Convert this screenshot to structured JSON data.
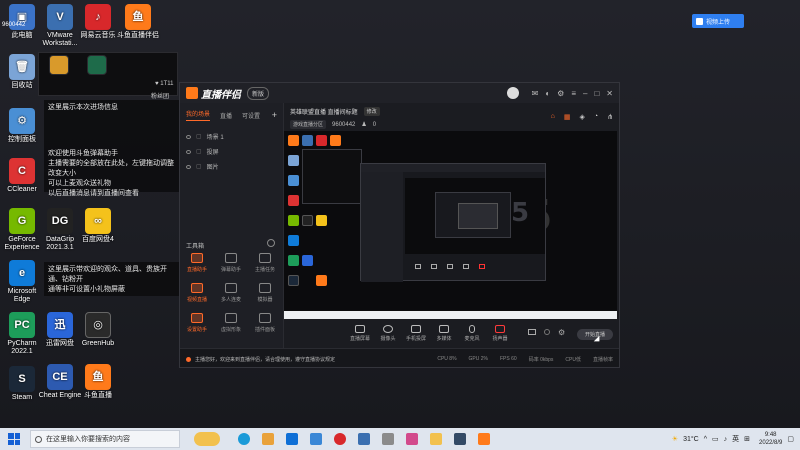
{
  "desktop": {
    "icons": [
      {
        "label": "此电脑",
        "color": "#3b73c8",
        "glyph": "▣"
      },
      {
        "label": "VMware Workstati...",
        "color": "#3b6fb0",
        "glyph": "V"
      },
      {
        "label": "网易云音乐",
        "color": "#d8282b",
        "glyph": "♪"
      },
      {
        "label": "斗鱼直播伴侣",
        "color": "#ff7a1a",
        "glyph": "鱼"
      },
      {
        "label": "回收站",
        "color": "#7ba4d6",
        "glyph": "🗑"
      },
      {
        "label": "控制面板",
        "color": "#4a8fd4",
        "glyph": "⚙"
      },
      {
        "label": "CCleaner",
        "color": "#d33",
        "glyph": "C"
      },
      {
        "label": "GeForce Experience",
        "color": "#76b900",
        "glyph": "G"
      },
      {
        "label": "DataGrip 2021.3.1",
        "color": "#222",
        "glyph": "DG"
      },
      {
        "label": "百度网盘4",
        "color": "#f4c21b",
        "glyph": "∞"
      },
      {
        "label": "Microsoft Edge",
        "color": "#0f7bd8",
        "glyph": "e"
      },
      {
        "label": "PyCharm 2022.1",
        "color": "#1d9d5a",
        "glyph": "PC"
      },
      {
        "label": "迅雷网盘",
        "color": "#2a66d9",
        "glyph": "迅"
      },
      {
        "label": "GreenHub",
        "color": "#2a2a2a",
        "glyph": "◎"
      },
      {
        "label": "Steam",
        "color": "#1b2838",
        "glyph": "S"
      },
      {
        "label": "Cheat Engine",
        "color": "#2d5ab0",
        "glyph": "CE"
      },
      {
        "label": "斗鱼直播",
        "color": "#ff7a1a",
        "glyph": "鱼"
      }
    ],
    "top_left_text": "9600442",
    "panel_stats": [
      "♥ 1T11",
      "粉丝团"
    ],
    "tip_lines": [
      "这里展示本次进场信息",
      "欢迎使用斗鱼弹幕助手",
      "主播需要的全部放在此处，左键拖动调整改变大小",
      "可以上麦观众送礼物",
      "以后直播消息请到直播间查看"
    ],
    "tip_lines2": [
      "这里展示带欢迎的观众、道具、贵族开通、钻粉开",
      "通等非可设置小礼物屏蔽"
    ]
  },
  "sys_button": "视频上传",
  "app": {
    "name": "直播伴侣",
    "badge": "新版",
    "tabs": [
      "我的场景",
      "直播",
      "可设置"
    ],
    "scenes": [
      "场景 1",
      "投屏",
      "图片"
    ],
    "tools_title": "工具箱",
    "tools": [
      {
        "label": "直播助手",
        "orange": true
      },
      {
        "label": "弹幕助手",
        "orange": false
      },
      {
        "label": "主播任务",
        "orange": false
      },
      {
        "label": "视频直播",
        "orange": true
      },
      {
        "label": "多人连麦",
        "orange": false
      },
      {
        "label": "模拟器",
        "orange": false
      },
      {
        "label": "设置助手",
        "orange": true
      },
      {
        "label": "虚拟形象",
        "orange": false
      },
      {
        "label": "插件面板",
        "orange": false
      }
    ],
    "preview_title": "英雄联盟直播 直播间标题",
    "preview_tag": "修改",
    "room_category": "游戏直播分区",
    "room_id": "9600442",
    "fans": "0",
    "controls": [
      {
        "label": "直播屏幕"
      },
      {
        "label": "摄像头"
      },
      {
        "label": "手机投屏"
      },
      {
        "label": "多媒体"
      },
      {
        "label": "麦克风"
      },
      {
        "label": "扬声器"
      }
    ],
    "go_live": "开始直播",
    "notice": "主播您好，欢迎来到直播伴侣，请合理使用，遵守直播协议规定",
    "stats": [
      "CPU 8%",
      "GPU 2%",
      "FPS 60",
      "码率 0kbps",
      "CPU低",
      "直播帧率"
    ]
  },
  "taskbar": {
    "search_placeholder": "在这里输入你要搜索的内容",
    "pinned": [
      "#1a9ad8",
      "#e9a23b",
      "#0f6fd6",
      "#3a87d6",
      "#d8282b",
      "#3b6fb0",
      "#8b8b8b",
      "#d24a8c",
      "#f2c14e",
      "#334a66",
      "#ff7a1a"
    ],
    "temperature": "31°C",
    "ime": "英",
    "time": "9:48",
    "date": "2022/8/9"
  }
}
